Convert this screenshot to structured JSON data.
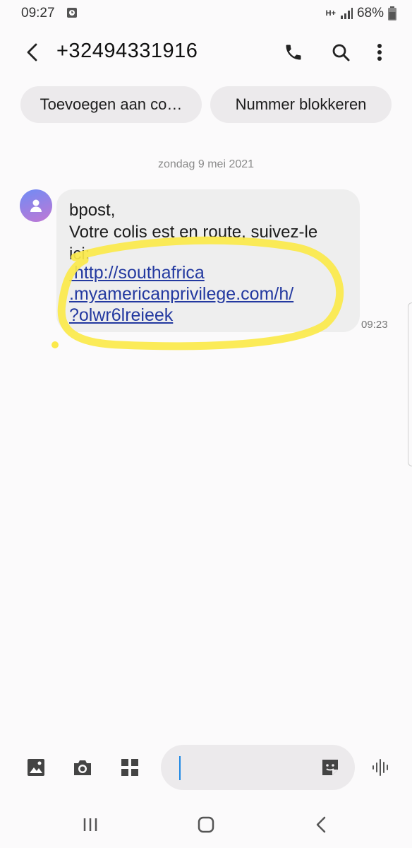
{
  "status": {
    "time": "09:27",
    "network": "H+",
    "battery": "68%"
  },
  "header": {
    "title": "+32494331916"
  },
  "actions": {
    "add_contact": "Toevoegen aan co…",
    "block_number": "Nummer blokkeren"
  },
  "conversation": {
    "date": "zondag 9 mei 2021",
    "message": {
      "text": "bpost,\nVotre colis est en route, suivez-le\nici:",
      "link": " http://southafrica\n.myamericanprivilege.com/h/\n?olwr6lreieek",
      "time": "09:23"
    }
  },
  "composer": {
    "value": ""
  },
  "colors": {
    "highlight": "#fbe94a",
    "link": "#2339a0",
    "accent": "#1e88e5"
  }
}
